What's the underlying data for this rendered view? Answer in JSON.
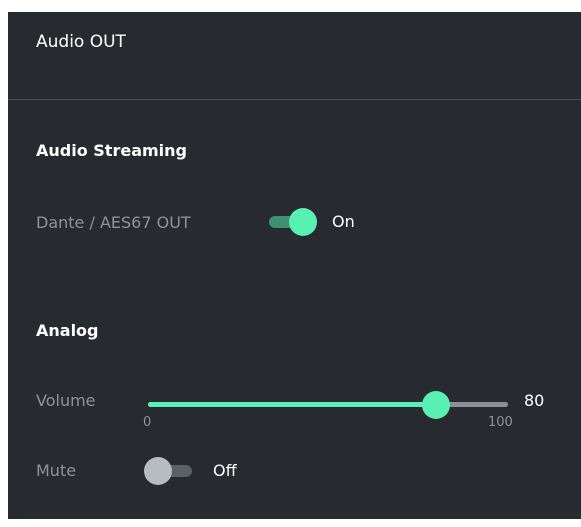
{
  "panel": {
    "title": "Audio OUT"
  },
  "colors": {
    "background": "#272b30",
    "accent": "#58f0b3",
    "label": "#8d939a"
  },
  "audio_streaming": {
    "title": "Audio Streaming",
    "dante": {
      "label": "Dante / AES67 OUT",
      "state_label": "On",
      "enabled": true
    }
  },
  "analog": {
    "title": "Analog",
    "volume": {
      "label": "Volume",
      "value": "80",
      "min": "0",
      "max": "100"
    },
    "mute": {
      "label": "Mute",
      "state_label": "Off",
      "enabled": false
    }
  }
}
